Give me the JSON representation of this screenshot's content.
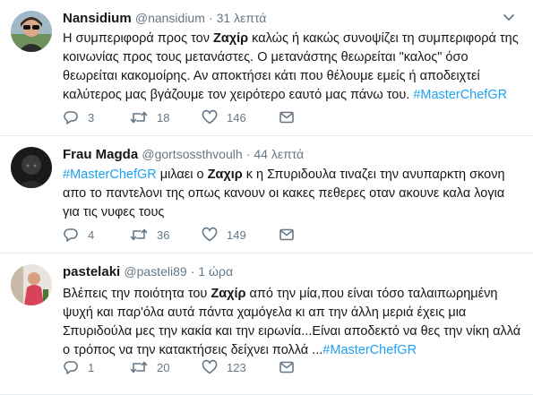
{
  "tweets": [
    {
      "name": "Nansidium",
      "handle": "@nansidium",
      "time": "· 31 λεπτά",
      "text_parts": {
        "p1": "Η συμπεριφορά προς τον ",
        "hl": "Ζαχίρ",
        "p2": " καλώς ή κακώς συνοψίζει τη συμπεριφορά της κοινωνίας προς τους μετανάστες. Ο μετανάστης θεωρείται \"καλος\" όσο θεωρείται κακομοίρης. Αν αποκτήσει κάτι που θέλουμε εμείς ή αποδειχτεί καλύτερος μας βγάζουμε τον χειρότερο εαυτό μας πάνω του. ",
        "tag": "#MasterChefGR"
      },
      "replies": "3",
      "retweets": "18",
      "likes": "146"
    },
    {
      "name": "Frau Magda",
      "handle": "@gortsossthvoulh",
      "time": "· 44 λεπτά",
      "text_parts": {
        "tag": "#MasterChefGR",
        "p1": " μιλαει ο ",
        "hl": "Ζαχιρ",
        "p2": " κ η Σπυριδουλα τιναζει την ανυπαρκτη σκονη απο το παντελονι της οπως κανουν οι κακες πεθερες οταν ακουνε καλα λογια για τις νυφες τους"
      },
      "replies": "4",
      "retweets": "36",
      "likes": "149"
    },
    {
      "name": "pastelaki",
      "handle": "@pasteli89",
      "time": "· 1 ώρα",
      "text_parts": {
        "p1": "Βλέπεις την ποιότητα του ",
        "hl": "Ζαχίρ",
        "p2": " από την μία,που είναι τόσο ταλαιπωρημένη ψυχή και παρ'όλα αυτά  πάντα χαμόγελα κι απ την άλλη μεριά έχεις μια Σπυριδούλα μες την κακία και την ειρωνία...Είναι αποδεκτό να θες την νίκη αλλά ο τρόπος να την κατακτήσεις δείχνει πολλά ...",
        "tag": "#MasterChefGR"
      },
      "replies": "1",
      "retweets": "20",
      "likes": "123"
    }
  ],
  "colors": {
    "hashtag": "#1da1f2",
    "meta": "#657786",
    "divider": "#e6ecf0"
  },
  "icons": [
    "reply-icon",
    "retweet-icon",
    "like-icon",
    "message-icon",
    "chevron-down-icon"
  ]
}
